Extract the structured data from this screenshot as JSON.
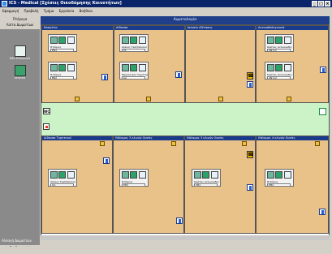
{
  "window": {
    "title": "ICS - Medical [Σχέσεις Οικοδόμησης Κοινοτήτων]"
  },
  "menu": [
    "Εφαρμογή",
    "Προβολή",
    "Τμήμα",
    "Εργαλεία",
    "Βοήθεια"
  ],
  "left_panel": {
    "header_top": "Πτέρυγα",
    "header_bottom": "Λίστα Δωματίων",
    "items": [
      {
        "label": "Νέα Εισαγωγή"
      },
      {
        "label": "Ιατρικό"
      }
    ],
    "footer_label": "Αλλαγή Δωματίων",
    "footer_button": "Επεξεργασία"
  },
  "main_title": "Αιματολογία",
  "rooms": [
    {
      "title": "Νοσηλεία",
      "cards": [
        {
          "name": "Θ Κύριος",
          "field": "ΕΝ1"
        },
        {
          "name": "Θ Κύριος",
          "field": "ΕΝ2"
        }
      ]
    },
    {
      "title": "Αίθουσα",
      "cards": [
        {
          "name": "Αλέκος Τερζόπουλος",
          "field": "Σ1"
        },
        {
          "name": "Μαγνητικός Τεχνίτης",
          "field": "ΑΑ"
        }
      ]
    },
    {
      "title": "Ιατρείο εξέτασης",
      "cards": []
    },
    {
      "title": "Αντικαθοδηγητικό",
      "cards": [
        {
          "name": "Κώστας Αντωνιαδης",
          "field": "ΑΝτο1"
        },
        {
          "name": "Κώστας Αντωνιαδης",
          "field": "ΑΝτο2"
        }
      ]
    },
    {
      "title": "Αίθουσα Τηρητικού",
      "cards": [
        {
          "name": "Αλέκος Τερζόπουλος",
          "field": "Ι11"
        }
      ]
    },
    {
      "title": "Θάλαμος 3 κλινών Ουσίες",
      "cards": [
        {
          "name": "Θ Κύριος",
          "field": "ΕΘ1"
        }
      ]
    },
    {
      "title": "Θάλαμος 3 κλινών Ουσίες",
      "cards": [
        {
          "name": "Κώστας Αντωνιαδης",
          "field": "ΣΘ1"
        }
      ]
    },
    {
      "title": "Θάλαμος 4 κλινών Ουσίες",
      "cards": [
        {
          "name": "Θ Κύριος",
          "field": "ΕΘ2"
        }
      ]
    }
  ],
  "corridor": {
    "wc_label": "WC"
  }
}
